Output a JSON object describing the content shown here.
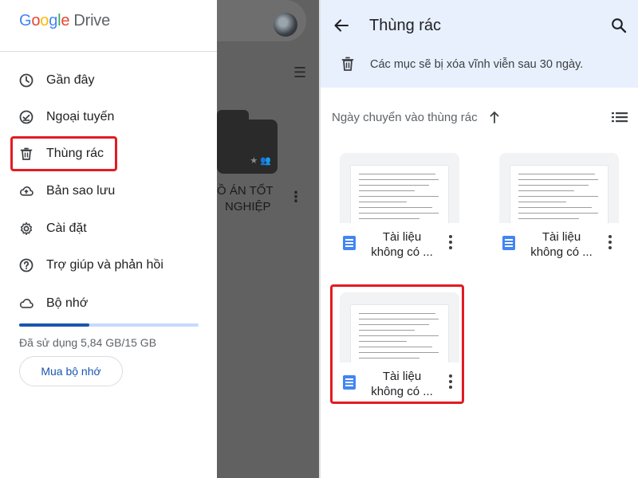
{
  "drawer": {
    "logo_google": "Google",
    "logo_drive": "Drive",
    "items": [
      {
        "label": "Gần đây",
        "icon": "clock-icon"
      },
      {
        "label": "Ngoại tuyến",
        "icon": "offline-check-icon"
      },
      {
        "label": "Thùng rác",
        "icon": "trash-icon"
      },
      {
        "label": "Bản sao lưu",
        "icon": "cloud-upload-icon"
      },
      {
        "label": "Cài đặt",
        "icon": "gear-icon"
      },
      {
        "label": "Trợ giúp và phản hồi",
        "icon": "help-icon"
      },
      {
        "label": "Bộ nhớ",
        "icon": "cloud-icon"
      }
    ],
    "storage_used_fraction": 0.389,
    "storage_text": "Đã sử dụng 5,84 GB/15 GB",
    "buy_button": "Mua bộ nhớ"
  },
  "background_app": {
    "folder_name_line1": "Ồ ÁN TỐT",
    "folder_name_line2": "NGHIỆP"
  },
  "trash": {
    "title": "Thùng rác",
    "notice": "Các mục sẽ bị xóa vĩnh viễn sau 30 ngày.",
    "sort_label": "Ngày chuyển vào thùng rác",
    "files": [
      {
        "name_line1": "Tài liệu",
        "name_line2": "không có ..."
      },
      {
        "name_line1": "Tài liệu",
        "name_line2": "không có ..."
      },
      {
        "name_line1": "Tài liệu",
        "name_line2": "không có ..."
      }
    ]
  },
  "colors": {
    "highlight": "#e31b23",
    "accent_blue": "#1a56b0",
    "doc_blue": "#4285f4",
    "topbar": "#e8f0fe"
  }
}
